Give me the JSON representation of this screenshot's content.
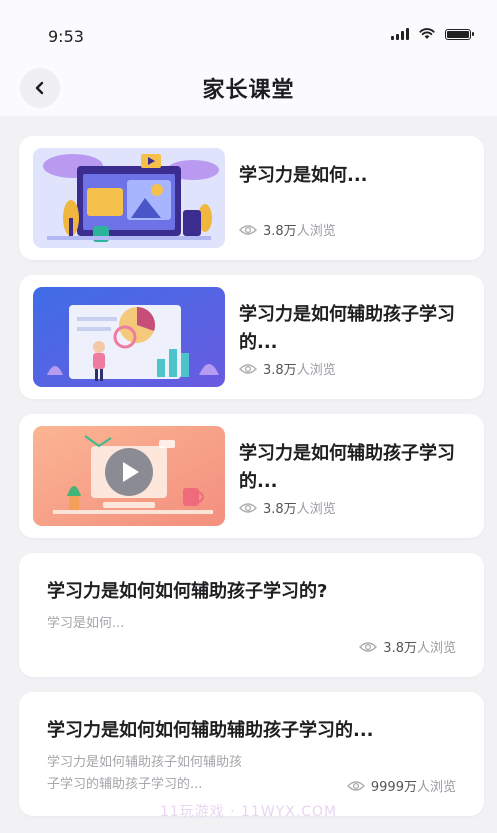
{
  "status_bar": {
    "time": "9:53"
  },
  "nav": {
    "title": "家长课堂"
  },
  "articles": [
    {
      "title": "学习力是如何...",
      "views": "3.8万",
      "views_unit": "人浏览"
    },
    {
      "title": "学习力是如何辅助孩子学习的...",
      "views": "3.8万",
      "views_unit": "人浏览"
    },
    {
      "title": "学习力是如何辅助孩子学习的...",
      "views": "3.8万",
      "views_unit": "人浏览"
    },
    {
      "title": "学习力是如何如何辅助孩子学习的?",
      "desc": "学习是如何...",
      "views": "3.8万",
      "views_unit": "人浏览"
    },
    {
      "title": "学习力是如何如何辅助辅助孩子学习的...",
      "desc_line1": "学习力是如何辅助孩子如何辅助孩",
      "desc_line2": "子学习的辅助孩子学习的...",
      "views": "9999万",
      "views_unit": "人浏览"
    }
  ],
  "watermark": "11玩游戏 · 11WYX.COM",
  "colors": {
    "background": "#f2f2f5",
    "card": "#ffffff",
    "meta_text": "#9a9aa2"
  },
  "icons": {
    "back": "chevron-left-icon",
    "views": "eye-icon"
  }
}
